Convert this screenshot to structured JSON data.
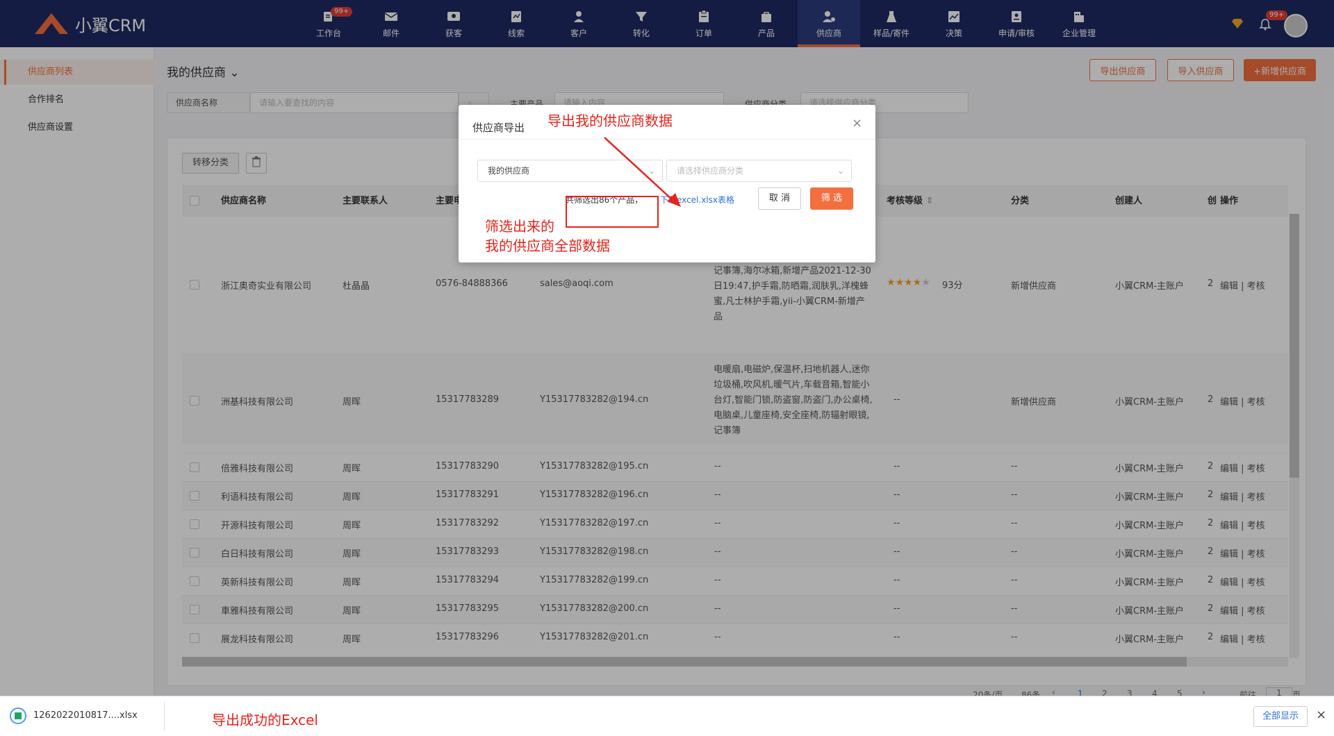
{
  "app": {
    "logo_text": "小翼CRM"
  },
  "nav": {
    "items": [
      {
        "label": "工作台",
        "badge": "99+"
      },
      {
        "label": "邮件"
      },
      {
        "label": "获客"
      },
      {
        "label": "线索"
      },
      {
        "label": "客户"
      },
      {
        "label": "转化"
      },
      {
        "label": "订单"
      },
      {
        "label": "产品"
      },
      {
        "label": "供应商",
        "active": true
      },
      {
        "label": "样品/寄件"
      },
      {
        "label": "决策"
      },
      {
        "label": "申请/审核"
      },
      {
        "label": "企业管理"
      }
    ],
    "bell_badge": "99+"
  },
  "sidebar": {
    "items": [
      {
        "label": "供应商列表",
        "active": true
      },
      {
        "label": "合作排名"
      },
      {
        "label": "供应商设置"
      }
    ]
  },
  "page": {
    "title": "我的供应商",
    "buttons": {
      "export": "导出供应商",
      "import": "导入供应商",
      "add": "+新增供应商"
    },
    "filters": {
      "name_select": "供应商名称",
      "search_placeholder": "请输入要查找的内容",
      "product_label": "主要产品",
      "product_placeholder": "请输入内容",
      "category_label": "供应商分类",
      "category_placeholder": "请选择供应商分类"
    },
    "toolbar": {
      "transfer": "转移分类"
    }
  },
  "table": {
    "headers": [
      "供应商名称",
      "主要联系人",
      "主要电",
      "考核等级",
      "分类",
      "创建人",
      "创",
      "操作"
    ],
    "rows": [
      {
        "name": "浙江奥奇实业有限公司",
        "contact": "杜晶晶",
        "phone": "0576-84888366",
        "email": "sales@aoqi.com",
        "products": "电脑桌,儿童座椅,安全座椅,防辐射眼镜,记事簿,海尔冰箱,新增产品2021-12-30日19:47,护手霜,防晒霜,润肤乳,洋槐蜂蜜,凡士林护手霜,yii-小翼CRM-新增产品",
        "products_top": "…",
        "rating": "93分",
        "category": "新增供应商",
        "creator": "小翼CRM-主账户",
        "created": "2",
        "ops": "编辑 | 考核"
      },
      {
        "name": "洲基科技有限公司",
        "contact": "周晖",
        "phone": "15317783289",
        "email": "Y15317783282@194.cn",
        "products": "电暖扇,电磁炉,保温杯,扫地机器人,迷你垃圾桶,吹风机,暖气片,车载音箱,智能小台灯,智能门锁,防盗窗,防盗门,办公桌椅,电脑桌,儿童座椅,安全座椅,防辐射眼镜,记事簿",
        "rating": "--",
        "category": "新增供应商",
        "creator": "小翼CRM-主账户",
        "created": "2",
        "ops": "编辑 | 考核"
      },
      {
        "name": "倍雅科技有限公司",
        "contact": "周晖",
        "phone": "15317783290",
        "email": "Y15317783282@195.cn",
        "products": "--",
        "rating": "--",
        "category": "--",
        "creator": "小翼CRM-主账户",
        "created": "2",
        "ops": "编辑 | 考核"
      },
      {
        "name": "利语科技有限公司",
        "contact": "周晖",
        "phone": "15317783291",
        "email": "Y15317783282@196.cn",
        "products": "--",
        "rating": "--",
        "category": "--",
        "creator": "小翼CRM-主账户",
        "created": "2",
        "ops": "编辑 | 考核"
      },
      {
        "name": "开源科技有限公司",
        "contact": "周晖",
        "phone": "15317783292",
        "email": "Y15317783282@197.cn",
        "products": "--",
        "rating": "--",
        "category": "--",
        "creator": "小翼CRM-主账户",
        "created": "2",
        "ops": "编辑 | 考核"
      },
      {
        "name": "白日科技有限公司",
        "contact": "周晖",
        "phone": "15317783293",
        "email": "Y15317783282@198.cn",
        "products": "--",
        "rating": "--",
        "category": "--",
        "creator": "小翼CRM-主账户",
        "created": "2",
        "ops": "编辑 | 考核"
      },
      {
        "name": "英新科技有限公司",
        "contact": "周晖",
        "phone": "15317783294",
        "email": "Y15317783282@199.cn",
        "products": "--",
        "rating": "--",
        "category": "--",
        "creator": "小翼CRM-主账户",
        "created": "2",
        "ops": "编辑 | 考核"
      },
      {
        "name": "車雅科技有限公司",
        "contact": "周晖",
        "phone": "15317783295",
        "email": "Y15317783282@200.cn",
        "products": "--",
        "rating": "--",
        "category": "--",
        "creator": "小翼CRM-主账户",
        "created": "2",
        "ops": "编辑 | 考核"
      },
      {
        "name": "展龙科技有限公司",
        "contact": "周晖",
        "phone": "15317783296",
        "email": "Y15317783282@201.cn",
        "products": "--",
        "rating": "--",
        "category": "--",
        "creator": "小翼CRM-主账户",
        "created": "2",
        "ops": "编辑 | 考核"
      }
    ],
    "rating_stars": 4
  },
  "pager": {
    "per_page": "20条/页",
    "total": "86条",
    "pages": [
      "1",
      "2",
      "3",
      "4",
      "5"
    ],
    "goto_label": "前往",
    "goto_value": "1",
    "page_suffix": "页"
  },
  "modal": {
    "title": "供应商导出",
    "select_scope": "我的供应商",
    "select_category_placeholder": "请选择供应商分类",
    "result_text": "共筛选出86个产品，",
    "download_link": "下载excel.xlsx表格",
    "cancel": "取 消",
    "filter": "筛 选"
  },
  "annotations": {
    "export_data": "导出我的供应商数据",
    "filtered_line1": "筛选出来的",
    "filtered_line2": "我的供应商全部数据",
    "excel_success": "导出成功的Excel"
  },
  "download_bar": {
    "file_name": "1262022010817....xlsx",
    "show_all": "全部显示"
  },
  "colors": {
    "nav_bg": "#1f2a63",
    "accent": "#f46f3e",
    "annotation": "#e8221b",
    "link": "#2f6fd6"
  }
}
